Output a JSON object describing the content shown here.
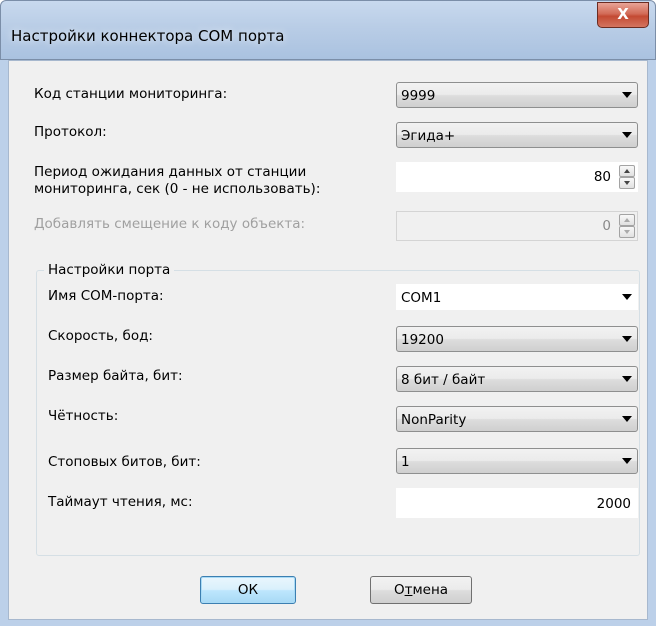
{
  "window": {
    "title": "Настройки коннектора COM порта",
    "close_glyph": "X"
  },
  "fields": {
    "station_code": {
      "label": "Код станции мониторинга:",
      "value": "9999"
    },
    "protocol": {
      "label": "Протокол:",
      "value": "Эгида+"
    },
    "timeout_period": {
      "label_line1": "Период ожидания данных от станции",
      "label_line2": "мониторинга, сек (0 - не использовать):",
      "value": "80"
    },
    "object_offset": {
      "label": "Добавлять смещение к коду объекта:",
      "value": "0",
      "disabled": true
    }
  },
  "port_settings": {
    "group_title": "Настройки порта",
    "port_name": {
      "label": "Имя COM-порта:",
      "value": "COM1"
    },
    "baud_rate": {
      "label": "Скорость, бод:",
      "value": "19200"
    },
    "byte_size": {
      "label": "Размер байта, бит:",
      "value": "8 бит / байт"
    },
    "parity": {
      "label": "Чётность:",
      "value": "NonParity"
    },
    "stop_bits": {
      "label": "Стоповых битов, бит:",
      "value": "1"
    },
    "read_timeout": {
      "label": "Таймаут чтения, мс:",
      "value": "2000"
    }
  },
  "buttons": {
    "ok": "ОК",
    "cancel_prefix": "О",
    "cancel_underlined": "т",
    "cancel_suffix": "мена"
  },
  "colors": {
    "close_button": "#c34a33",
    "default_button_border": "#3c7fb1"
  }
}
